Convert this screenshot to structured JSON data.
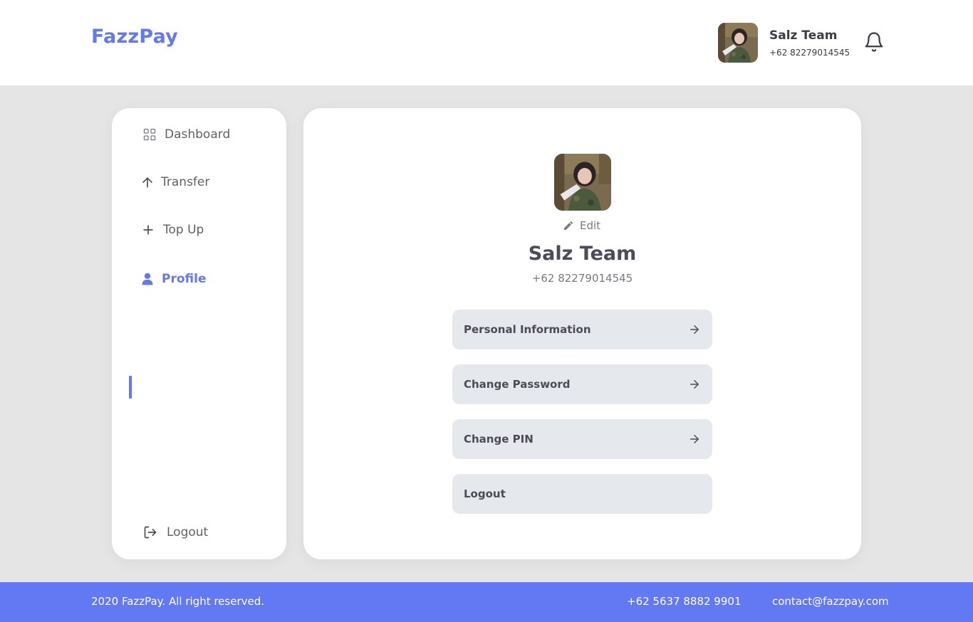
{
  "header": {
    "brand": "FazzPay",
    "user_name": "Salz Team",
    "user_phone": "+62 82279014545"
  },
  "sidebar": {
    "items": [
      {
        "label": "Dashboard",
        "icon": "grid-icon"
      },
      {
        "label": "Transfer",
        "icon": "arrow-up-icon"
      },
      {
        "label": "Top Up",
        "icon": "plus-icon"
      },
      {
        "label": "Profile",
        "icon": "user-icon",
        "active": true
      }
    ],
    "logout_label": "Logout"
  },
  "profile": {
    "edit_label": "Edit",
    "name": "Salz Team",
    "phone": "+62 82279014545",
    "menu": [
      {
        "label": "Personal Information",
        "arrow": true
      },
      {
        "label": "Change Password",
        "arrow": true
      },
      {
        "label": "Change PIN",
        "arrow": true
      },
      {
        "label": "Logout",
        "arrow": false
      }
    ]
  },
  "footer": {
    "copyright": "2020 FazzPay. All right reserved.",
    "phone": "+62 5637 8882 9901",
    "email": "contact@fazzpay.com"
  },
  "colors": {
    "accent": "#6379f4",
    "background": "#e5e5e5",
    "menu_button": "#e5e8ed"
  }
}
